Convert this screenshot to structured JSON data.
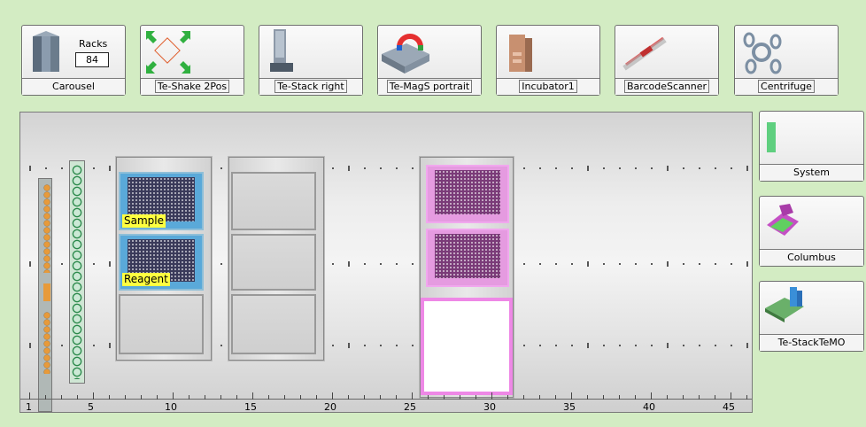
{
  "toolbar": {
    "carousel": {
      "label": "Carousel",
      "racks_title": "Racks",
      "racks_value": "84"
    },
    "te_shake": {
      "label": "Te-Shake 2Pos"
    },
    "te_stack_right": {
      "label": "Te-Stack right"
    },
    "te_mags": {
      "label": "Te-MagS portrait"
    },
    "incubator": {
      "label": "Incubator1"
    },
    "barcode": {
      "label": "BarcodeScanner"
    },
    "centrifuge": {
      "label": "Centrifuge"
    }
  },
  "side_panel": {
    "system": {
      "label": "System"
    },
    "columbus": {
      "label": "Columbus"
    },
    "te_stack_temo": {
      "label": "Te-StackTeMO"
    }
  },
  "deck": {
    "labels": {
      "sample": "Sample",
      "reagent": "Reagent"
    },
    "axis_ticks": [
      "1",
      "5",
      "10",
      "15",
      "20",
      "25",
      "30",
      "35",
      "40",
      "45"
    ]
  },
  "colors": {
    "background": "#d3ecc3",
    "plate_blue": "#5aa9d9",
    "plate_pink": "#e59be0",
    "label_yellow": "#ffff40",
    "system_green": "#5fcf7f"
  }
}
